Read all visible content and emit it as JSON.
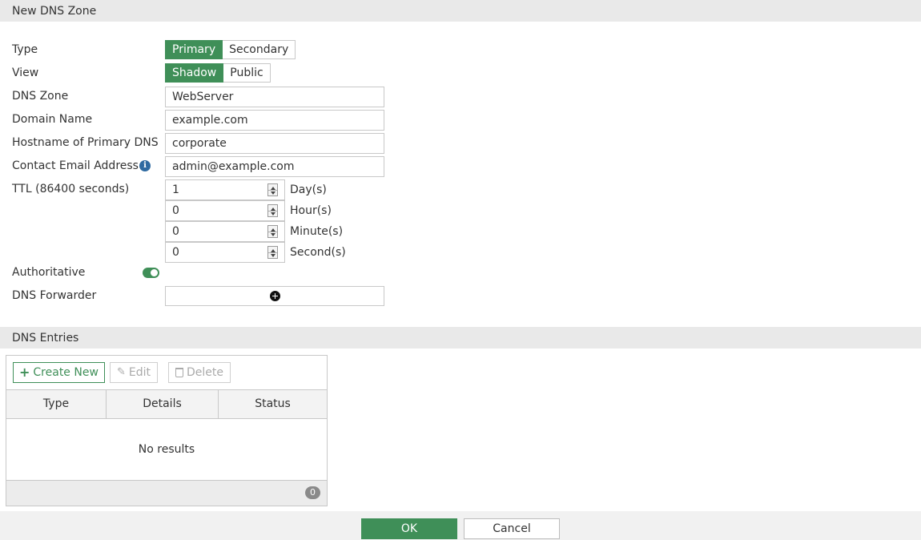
{
  "header": {
    "title": "New DNS Zone"
  },
  "form": {
    "type": {
      "label": "Type",
      "options": [
        "Primary",
        "Secondary"
      ],
      "selected": "Primary"
    },
    "view": {
      "label": "View",
      "options": [
        "Shadow",
        "Public"
      ],
      "selected": "Shadow"
    },
    "dns_zone": {
      "label": "DNS Zone",
      "value": "WebServer"
    },
    "domain_name": {
      "label": "Domain Name",
      "value": "example.com"
    },
    "hostname": {
      "label": "Hostname of Primary DNS",
      "value": "corporate"
    },
    "contact_email": {
      "label": "Contact Email Address",
      "value": "admin@example.com",
      "info_icon": "info-circle-icon"
    },
    "ttl": {
      "label": "TTL (86400 seconds)",
      "days": {
        "value": "1",
        "unit": "Day(s)"
      },
      "hours": {
        "value": "0",
        "unit": "Hour(s)"
      },
      "minutes": {
        "value": "0",
        "unit": "Minute(s)"
      },
      "seconds": {
        "value": "0",
        "unit": "Second(s)"
      }
    },
    "authoritative": {
      "label": "Authoritative",
      "enabled": true
    },
    "dns_forwarder": {
      "label": "DNS Forwarder",
      "add_icon": "plus-circle-icon"
    }
  },
  "entries": {
    "title": "DNS Entries",
    "toolbar": {
      "create_label": "Create New",
      "edit_label": "Edit",
      "delete_label": "Delete"
    },
    "columns": [
      "Type",
      "Details",
      "Status"
    ],
    "empty_text": "No results",
    "count": "0"
  },
  "footer": {
    "ok_label": "OK",
    "cancel_label": "Cancel"
  },
  "colors": {
    "accent": "#3f8f58",
    "info": "#2f6aa1",
    "section_bg": "#e9e9e9"
  }
}
